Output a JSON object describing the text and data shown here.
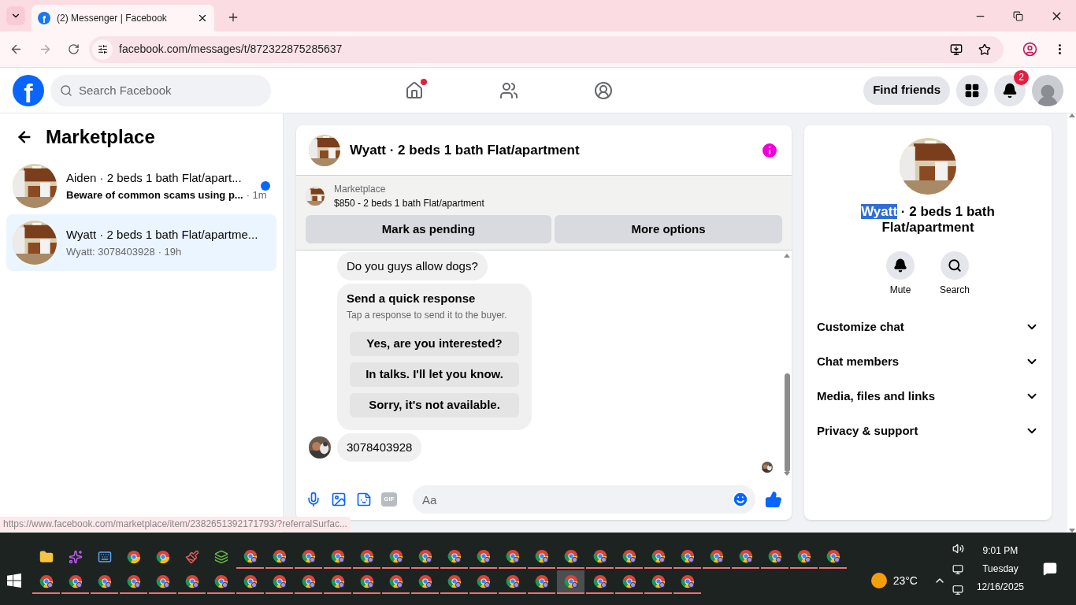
{
  "browser": {
    "tab": {
      "favicon_text": "f",
      "title": "(2) Messenger | Facebook"
    },
    "url": "facebook.com/messages/t/872322875285637"
  },
  "header": {
    "logo": "f",
    "search": {
      "placeholder": "Search Facebook"
    },
    "nav": [
      {
        "kind": "home",
        "selected": false,
        "notification_dot": true
      },
      {
        "kind": "friends",
        "selected": false,
        "notification_dot": false
      },
      {
        "kind": "groups",
        "selected": false,
        "notification_dot": false
      }
    ],
    "find_friends": "Find friends",
    "notifications_badge": "2"
  },
  "sidebar": {
    "title": "Marketplace",
    "conversations": [
      {
        "title": "Aiden · 2 beds 1 bath Flat/apart...",
        "preview": "Beware of common scams using p...",
        "time": "· 1m",
        "unread": true,
        "selected": false
      },
      {
        "title": "Wyatt · 2 beds 1 bath Flat/apartme...",
        "preview": "Wyatt: 3078403928",
        "time": "· 19h",
        "unread": false,
        "selected": true
      }
    ]
  },
  "chat": {
    "title": "Wyatt · 2 beds 1 bath Flat/apartment",
    "listing": {
      "label": "Marketplace",
      "text": "$850 - 2 beds 1 bath Flat/apartment",
      "buttons": [
        "Mark as pending",
        "More options"
      ]
    },
    "messages": [
      {
        "kind": "text",
        "text": "Do you guys allow dogs?",
        "show_avatar": false
      },
      {
        "kind": "quick_response",
        "title": "Send a quick response",
        "subtitle": "Tap a response to send it to the buyer.",
        "options": [
          "Yes, are you interested?",
          "In talks. I'll let you know.",
          "Sorry, it's not available."
        ]
      },
      {
        "kind": "text",
        "text": "3078403928",
        "show_avatar": true
      }
    ],
    "seen_avatar": true,
    "composer": {
      "placeholder": "Aa",
      "gif_label": "GIF"
    }
  },
  "details": {
    "title_parts": [
      {
        "text": "Wyatt",
        "selected": true
      },
      {
        "text": " · 2 beds 1 bath Flat/apartment",
        "selected": false
      }
    ],
    "actions": [
      {
        "kind": "mute",
        "label": "Mute"
      },
      {
        "kind": "search",
        "label": "Search"
      }
    ],
    "sections": [
      {
        "label": "Customize chat",
        "expanded": false
      },
      {
        "label": "Chat members",
        "expanded": false
      },
      {
        "label": "Media, files and links",
        "expanded": false
      },
      {
        "label": "Privacy & support",
        "expanded": false
      }
    ]
  },
  "status_url": "https://www.facebook.com/marketplace/item/2382651392171793/?referralSurfac...",
  "taskbar": {
    "row_1": [
      {
        "kind": "folder",
        "selected": false
      },
      {
        "kind": "copilot",
        "selected": false
      },
      {
        "kind": "keyboard",
        "selected": false
      },
      {
        "kind": "chrome",
        "selected": false
      },
      {
        "kind": "chrome",
        "selected": false
      },
      {
        "kind": "paint",
        "selected": false
      },
      {
        "kind": "stack",
        "selected": false
      },
      {
        "kind": "chrome_profile",
        "selected": false
      },
      {
        "kind": "chrome_profile",
        "selected": false
      },
      {
        "kind": "chrome_profile",
        "selected": false
      },
      {
        "kind": "chrome_profile",
        "selected": false
      },
      {
        "kind": "chrome_profile",
        "selected": false
      },
      {
        "kind": "chrome_profile",
        "selected": false
      },
      {
        "kind": "chrome_profile",
        "selected": false
      },
      {
        "kind": "chrome_profile",
        "selected": false
      },
      {
        "kind": "chrome_profile",
        "selected": false
      },
      {
        "kind": "chrome_profile",
        "selected": false
      },
      {
        "kind": "chrome_profile",
        "selected": false
      },
      {
        "kind": "chrome_profile",
        "selected": false
      },
      {
        "kind": "chrome_profile",
        "selected": false
      },
      {
        "kind": "chrome_profile",
        "selected": false
      },
      {
        "kind": "chrome_profile",
        "selected": false
      },
      {
        "kind": "chrome_profile",
        "selected": false
      },
      {
        "kind": "chrome_profile",
        "selected": false
      },
      {
        "kind": "chrome_profile",
        "selected": false
      },
      {
        "kind": "chrome_profile",
        "selected": false
      },
      {
        "kind": "chrome_profile",
        "selected": false
      },
      {
        "kind": "chrome_profile",
        "selected": false
      }
    ],
    "row_2": [
      {
        "kind": "chrome_profile",
        "selected": false
      },
      {
        "kind": "chrome_profile",
        "selected": false
      },
      {
        "kind": "chrome_profile",
        "selected": false
      },
      {
        "kind": "chrome_profile",
        "selected": false
      },
      {
        "kind": "chrome_profile",
        "selected": false
      },
      {
        "kind": "chrome_profile",
        "selected": false
      },
      {
        "kind": "chrome_profile",
        "selected": false
      },
      {
        "kind": "chrome_profile",
        "selected": false
      },
      {
        "kind": "chrome_profile",
        "selected": false
      },
      {
        "kind": "chrome_profile",
        "selected": false
      },
      {
        "kind": "chrome_profile",
        "selected": false
      },
      {
        "kind": "chrome_profile",
        "selected": false
      },
      {
        "kind": "chrome_profile",
        "selected": false
      },
      {
        "kind": "chrome_profile",
        "selected": false
      },
      {
        "kind": "chrome_profile",
        "selected": false
      },
      {
        "kind": "chrome_profile",
        "selected": false
      },
      {
        "kind": "chrome_profile",
        "selected": false
      },
      {
        "kind": "chrome_profile",
        "selected": false
      },
      {
        "kind": "chrome_profile",
        "selected": true
      },
      {
        "kind": "chrome_profile",
        "selected": false
      },
      {
        "kind": "chrome_profile",
        "selected": false
      },
      {
        "kind": "chrome_profile",
        "selected": false
      },
      {
        "kind": "chrome_profile",
        "selected": false
      }
    ],
    "temperature": "23°C",
    "time": "9:01 PM",
    "day": "Tuesday",
    "date": "12/16/2025"
  }
}
